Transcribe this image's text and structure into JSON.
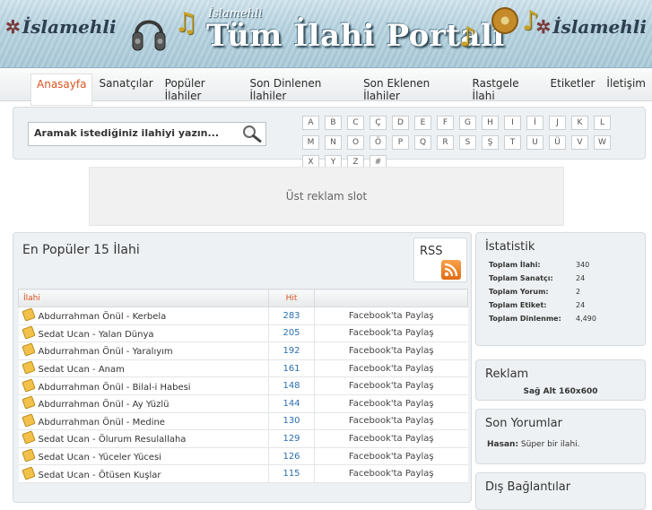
{
  "header": {
    "logo_left": "İslamehli",
    "logo_right": "İslamehli",
    "subtitle": "İslamehli",
    "title": "Tüm İlahi Portalı"
  },
  "nav": {
    "items": [
      "Anasayfa",
      "Sanatçılar",
      "Popüler İlahiler",
      "Son Dinlenen İlahiler",
      "Son Eklenen İlahiler",
      "Rastgele İlahi",
      "Etiketler",
      "İletişim"
    ],
    "active": "Anasayfa"
  },
  "search": {
    "placeholder": "Aramak istediğiniz ilahiyi yazın..."
  },
  "alphabet": {
    "row1": [
      "A",
      "B",
      "C",
      "Ç",
      "D",
      "E",
      "F",
      "G",
      "H",
      "I",
      "İ",
      "J",
      "K",
      "L",
      "M",
      "N"
    ],
    "row2": [
      "O",
      "Ö",
      "P",
      "Q",
      "R",
      "S",
      "Ş",
      "T",
      "U",
      "Ü",
      "V",
      "W",
      "X",
      "Y",
      "Z",
      "#"
    ]
  },
  "ad_top": "Üst reklam slot",
  "popular": {
    "title": "En Popüler 15 İlahi",
    "rss_label": "RSS",
    "col_ilahi": "İlahi",
    "col_hit": "Hit",
    "share_label": "Facebook'ta Paylaş",
    "rows": [
      {
        "name": "Abdurrahman Önül - Kerbela",
        "hit": "283"
      },
      {
        "name": "Sedat Ucan - Yalan Dünya",
        "hit": "205"
      },
      {
        "name": "Abdurrahman Önül - Yaralıyım",
        "hit": "192"
      },
      {
        "name": "Sedat Ucan - Anam",
        "hit": "161"
      },
      {
        "name": "Abdurrahman Önül - Bilal-i Habesi",
        "hit": "148"
      },
      {
        "name": "Abdurrahman Önül - Ay Yüzlü",
        "hit": "144"
      },
      {
        "name": "Abdurrahman Önül - Medine",
        "hit": "130"
      },
      {
        "name": "Sedat Ucan - Ölurum Resulallaha",
        "hit": "129"
      },
      {
        "name": "Sedat Ucan - Yüceler Yücesi",
        "hit": "126"
      },
      {
        "name": "Sedat Ucan - Ötüsen Kuşlar",
        "hit": "115"
      }
    ]
  },
  "stats": {
    "title": "İstatistik",
    "rows": [
      {
        "label": "Toplam İlahi:",
        "value": "340"
      },
      {
        "label": "Toplam Sanatçı:",
        "value": "24"
      },
      {
        "label": "Toplam Yorum:",
        "value": "2"
      },
      {
        "label": "Toplam Etiket:",
        "value": "24"
      },
      {
        "label": "Toplam Dinlenme:",
        "value": "4,490"
      }
    ]
  },
  "reklam": {
    "title": "Reklam",
    "slot": "Sağ Alt 160x600"
  },
  "comments": {
    "title": "Son Yorumlar",
    "author": "Hasan:",
    "text": "Süper bir ilahi."
  },
  "links": {
    "title": "Dış Bağlantılar"
  }
}
